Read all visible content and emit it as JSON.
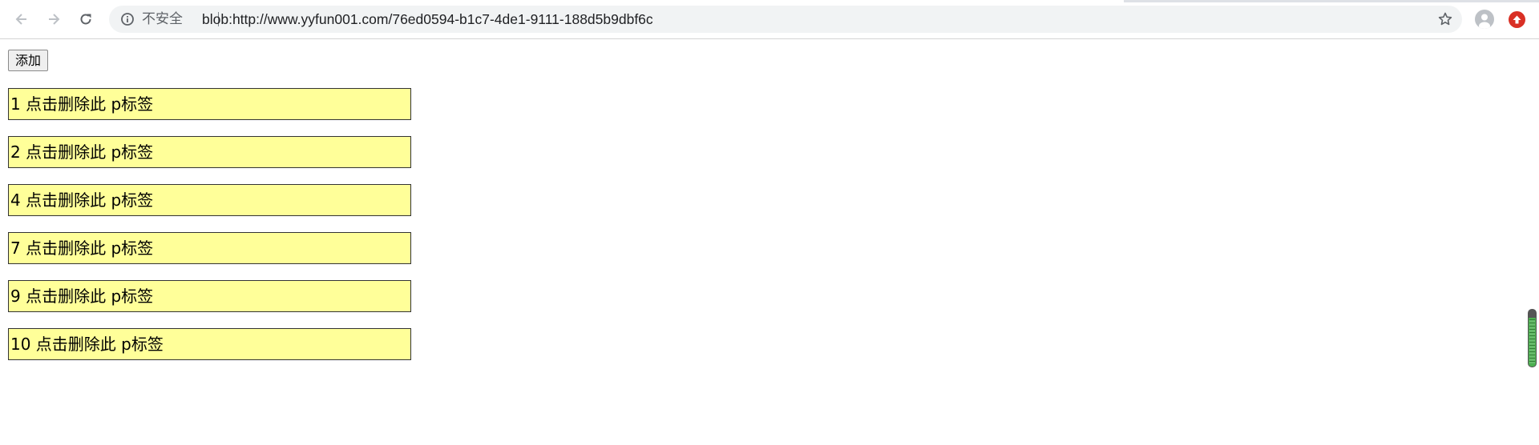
{
  "browser": {
    "security_label": "不安全",
    "url": "blob:http://www.yyfun001.com/76ed0594-b1c7-4de1-9111-188d5b9dbf6c",
    "icons": [
      "back-arrow-icon",
      "forward-arrow-icon",
      "reload-icon",
      "info-icon",
      "star-icon",
      "profile-avatar-icon",
      "update-arrow-icon"
    ]
  },
  "page": {
    "add_button_label": "添加",
    "items": [
      "1 点击删除此 p标签",
      "2 点击删除此 p标签",
      "4 点击删除此 p标签",
      "7 点击删除此 p标签",
      "9 点击删除此 p标签",
      "10 点击删除此 p标签"
    ]
  },
  "colors": {
    "item_background": "#ffff99",
    "item_border": "#333333",
    "update_badge": "#d93025"
  }
}
